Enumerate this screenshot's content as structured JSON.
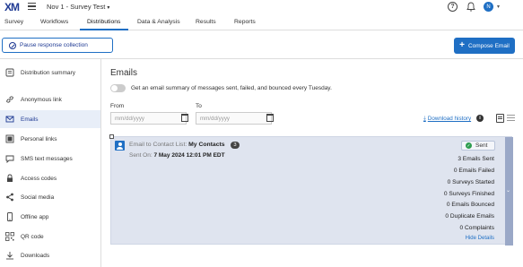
{
  "app": {
    "logo": "XM",
    "project_title": "Nov 1 - Survey Test",
    "avatar_initial": "N"
  },
  "tabs": [
    {
      "label": "Survey"
    },
    {
      "label": "Workflows"
    },
    {
      "label": "Distributions",
      "active": true
    },
    {
      "label": "Data & Analysis"
    },
    {
      "label": "Results"
    },
    {
      "label": "Reports"
    }
  ],
  "actions": {
    "pause_label": "Pause response collection",
    "compose_label": "Compose Email"
  },
  "sidebar": {
    "items": [
      {
        "label": "Distribution summary",
        "icon": "summary-icon"
      },
      {
        "label": "Anonymous link",
        "icon": "link-icon"
      },
      {
        "label": "Emails",
        "icon": "email-icon",
        "active": true
      },
      {
        "label": "Personal links",
        "icon": "personal-links-icon"
      },
      {
        "label": "SMS text messages",
        "icon": "sms-icon"
      },
      {
        "label": "Access codes",
        "icon": "lock-icon"
      },
      {
        "label": "Social media",
        "icon": "share-icon"
      },
      {
        "label": "Offline app",
        "icon": "tablet-icon"
      },
      {
        "label": "QR code",
        "icon": "qr-icon"
      },
      {
        "label": "Downloads",
        "icon": "download-icon"
      }
    ]
  },
  "main": {
    "title": "Emails",
    "toggle_label": "Get an email summary of messages sent, failed, and bounced every Tuesday.",
    "from_label": "From",
    "to_label": "To",
    "date_placeholder": "mm/dd/yyyy",
    "download_history": "Download history"
  },
  "distribution": {
    "title_prefix": "Email to Contact List:",
    "list_name": "My Contacts",
    "count": "3",
    "sent_on_prefix": "Sent On:",
    "sent_on_value": "7 May 2024 12:01 PM EDT",
    "status": "Sent",
    "stats": [
      "3 Emails Sent",
      "0 Emails Failed",
      "0 Surveys Started",
      "0 Surveys Finished",
      "0 Emails Bounced",
      "0 Duplicate Emails",
      "0 Complaints"
    ],
    "hide_details": "Hide Details"
  },
  "colors": {
    "accent": "#1f6fc4",
    "brand": "#1f3a93",
    "card_bg": "#dfe4ef",
    "success": "#2e9d4f"
  }
}
